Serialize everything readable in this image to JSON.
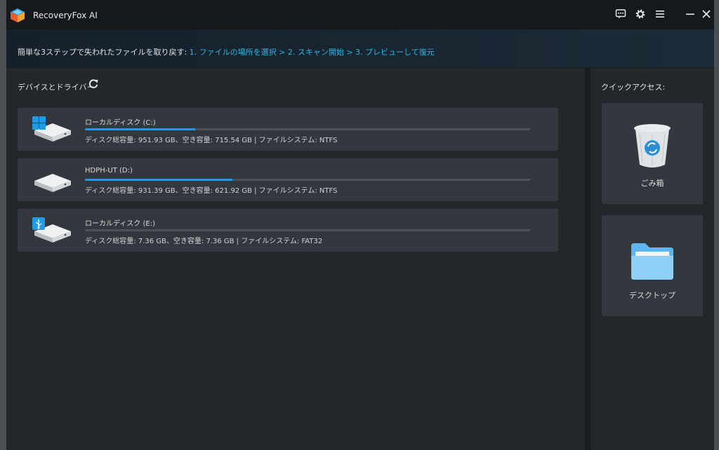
{
  "window": {
    "title": "RecoveryFox AI"
  },
  "banner": {
    "lead": "簡単な3ステップで失われたファイルを取り戻す: ",
    "steps": "1. ファイルの場所を選択 > 2. スキャン開始 > 3. プレビューして復元"
  },
  "devices": {
    "title": "デバイスとドライバー",
    "drives": [
      {
        "name": "ローカルディスク (C:)",
        "info": "ディスク総容量: 951.93 GB、空き容量: 715.54 GB | ファイルシステム: NTFS",
        "used_fraction": 0.248,
        "icon": "windows-drive-icon"
      },
      {
        "name": "HDPH-UT (D:)",
        "info": "ディスク総容量: 931.39 GB、空き容量: 621.92 GB | ファイルシステム: NTFS",
        "used_fraction": 0.332,
        "icon": "hard-drive-icon"
      },
      {
        "name": "ローカルディスク (E:)",
        "info": "ディスク総容量: 7.36 GB、空き容量: 7.36 GB | ファイルシステム: FAT32",
        "used_fraction": 0.0,
        "icon": "usb-drive-icon"
      }
    ]
  },
  "quick_access": {
    "title": "クイックアクセス:",
    "items": [
      {
        "label": "ごみ箱",
        "icon": "recycle-bin-icon"
      },
      {
        "label": "デスクトップ",
        "icon": "folder-icon"
      }
    ]
  },
  "colors": {
    "accent": "#1e9be6",
    "link": "#29b6e8",
    "card": "#33383e",
    "panel": "#23272c"
  }
}
